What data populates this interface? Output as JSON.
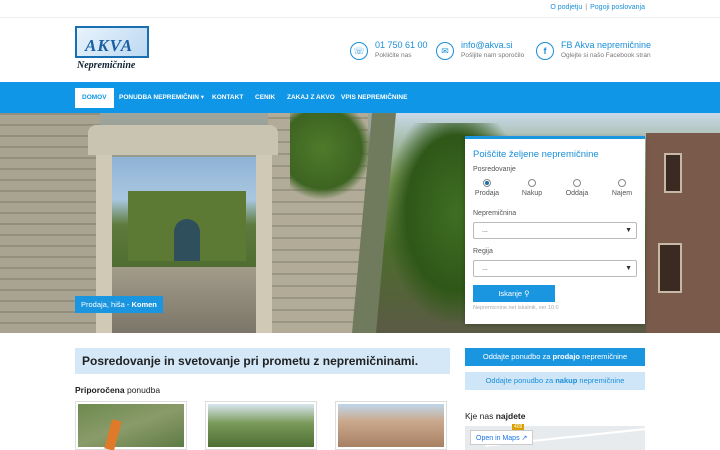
{
  "toplinks": {
    "about": "O podjetju",
    "sep": "|",
    "terms": "Pogoji poslovanja"
  },
  "logo": {
    "name": "AKVA",
    "tagline": "Nepremičnine"
  },
  "contacts": [
    {
      "icon": "phone-icon",
      "main": "01 750 61 00",
      "sub": "Pokličite nas"
    },
    {
      "icon": "mail-icon",
      "main": "info@akva.si",
      "sub": "Pošljite nam sporočilo"
    },
    {
      "icon": "facebook-icon",
      "main": "FB Akva nepremičnine",
      "sub": "Oglejte si našo Facebook stran"
    }
  ],
  "nav": {
    "items": [
      "DOMOV",
      "PONUDBA NEPREMIČNIN",
      "KONTAKT",
      "CENIK",
      "ZAKAJ Z AKVO",
      "VPIS NEPREMIČNINE"
    ],
    "dropdown_glyph": "▾"
  },
  "hero": {
    "caption_prefix": "Prodaja, hiša - ",
    "caption_place": "Komen"
  },
  "search": {
    "title": "Poiščite željene nepremičnine",
    "mediation_label": "Posredovanje",
    "options": [
      "Prodaja",
      "Nakup",
      "Oddaja",
      "Najem"
    ],
    "selected": "Prodaja",
    "property_label": "Nepremičnina",
    "property_value": "...",
    "region_label": "Regija",
    "region_value": "...",
    "button": "Iskanje",
    "footer": "Nepremicnine.net iskalnik, ver 10.0"
  },
  "content": {
    "headline": "Posredovanje in svetovanje pri prometu z nepremičninami.",
    "featured_bold": "Priporočena",
    "featured_rest": " ponudba"
  },
  "sidebar": {
    "sell_pre": "Oddajte ponudbo za ",
    "sell_bold": "prodajo",
    "sell_post": " nepremičnine",
    "buy_pre": "Oddajte ponudbo za ",
    "buy_bold": "nakup",
    "buy_post": " nepremičnine",
    "find_pre": "Kje nas ",
    "find_bold": "najdete",
    "map_open": "Open in Maps",
    "map_road": "409"
  },
  "colors": {
    "accent": "#0f96e6",
    "light": "#d4e8f8",
    "link": "#1a8fd8"
  }
}
